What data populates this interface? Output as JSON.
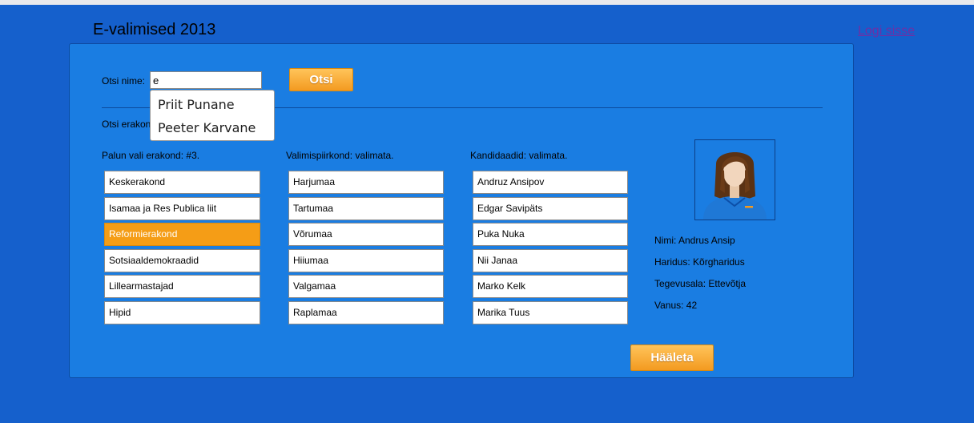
{
  "header": {
    "title": "E-valimised 2013",
    "login_link": "Logi sisse"
  },
  "search": {
    "label": "Otsi nime:",
    "value": "e",
    "button": "Otsi",
    "suggestions": [
      "Priit Punane",
      "Peeter Karvane"
    ]
  },
  "party_search": {
    "label": "Otsi erakon"
  },
  "parties": {
    "header": "Palun vali erakond: #3.",
    "items": [
      "Keskerakond",
      "Isamaa ja Res Publica liit",
      "Reformierakond",
      "Sotsiaaldemokraadid",
      "Lillearmastajad",
      "Hipid"
    ],
    "selected_index": 2
  },
  "districts": {
    "header": "Valimispiirkond: valimata.",
    "items": [
      "Harjumaa",
      "Tartumaa",
      "Võrumaa",
      "Hiiumaa",
      "Valgamaa",
      "Raplamaa"
    ]
  },
  "candidates": {
    "header": "Kandidaadid: valimata.",
    "items": [
      "Andruz Ansipov",
      "Edgar Savipäts",
      "Puka Nuka",
      "Nii Janaa",
      "Marko Kelk",
      "Marika Tuus"
    ]
  },
  "profile": {
    "avatar_icon": "person-avatar-icon",
    "name": "Nimi: Andrus Ansip",
    "education": "Haridus: Kõrgharidus",
    "occupation": "Tegevusala: Ettevõtja",
    "age": "Vanus: 42"
  },
  "vote_button": "Hääleta",
  "colors": {
    "background": "#1560cc",
    "panel": "#1a7de2",
    "accent": "#f59d16",
    "link": "#6f2fa5"
  }
}
